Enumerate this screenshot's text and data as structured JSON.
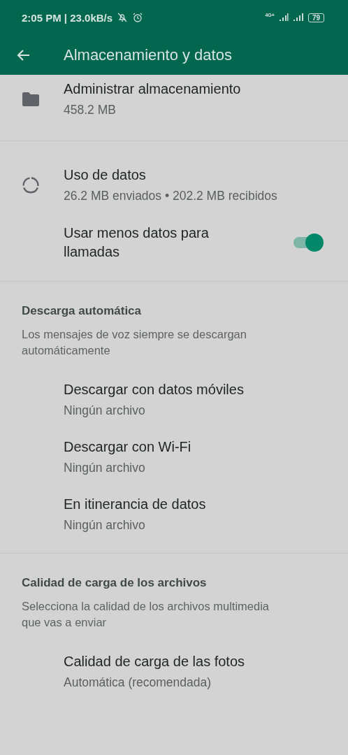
{
  "status_bar": {
    "time": "2:05 PM | 23.0kB/s",
    "network": "4G+",
    "battery": "79"
  },
  "app_bar": {
    "title": "Almacenamiento y datos"
  },
  "sections": [
    {
      "items": [
        {
          "kind": "storage",
          "title": "Administrar almacenamiento",
          "subtitle": "458.2 MB"
        }
      ]
    },
    {
      "items": [
        {
          "kind": "usage",
          "title": "Uso de datos",
          "subtitle": "26.2 MB enviados • 202.2 MB recibidos"
        },
        {
          "kind": "switch",
          "title": "Usar menos datos para llamadas",
          "on": true
        }
      ]
    },
    {
      "header": "Descarga automática",
      "description": "Los mensajes de voz siempre se descargan automáticamente",
      "items": [
        {
          "kind": "plain",
          "title": "Descargar con datos móviles",
          "subtitle": "Ningún archivo"
        },
        {
          "kind": "plain",
          "title": "Descargar con Wi-Fi",
          "subtitle": "Ningún archivo"
        },
        {
          "kind": "plain",
          "title": "En itinerancia de datos",
          "subtitle": "Ningún archivo"
        }
      ]
    },
    {
      "header": "Calidad de carga de los archivos",
      "description": "Selecciona la calidad de los archivos multimedia que vas a enviar",
      "items": [
        {
          "kind": "plain",
          "title": "Calidad de carga de las fotos",
          "subtitle": "Automática (recomendada)"
        }
      ]
    }
  ]
}
